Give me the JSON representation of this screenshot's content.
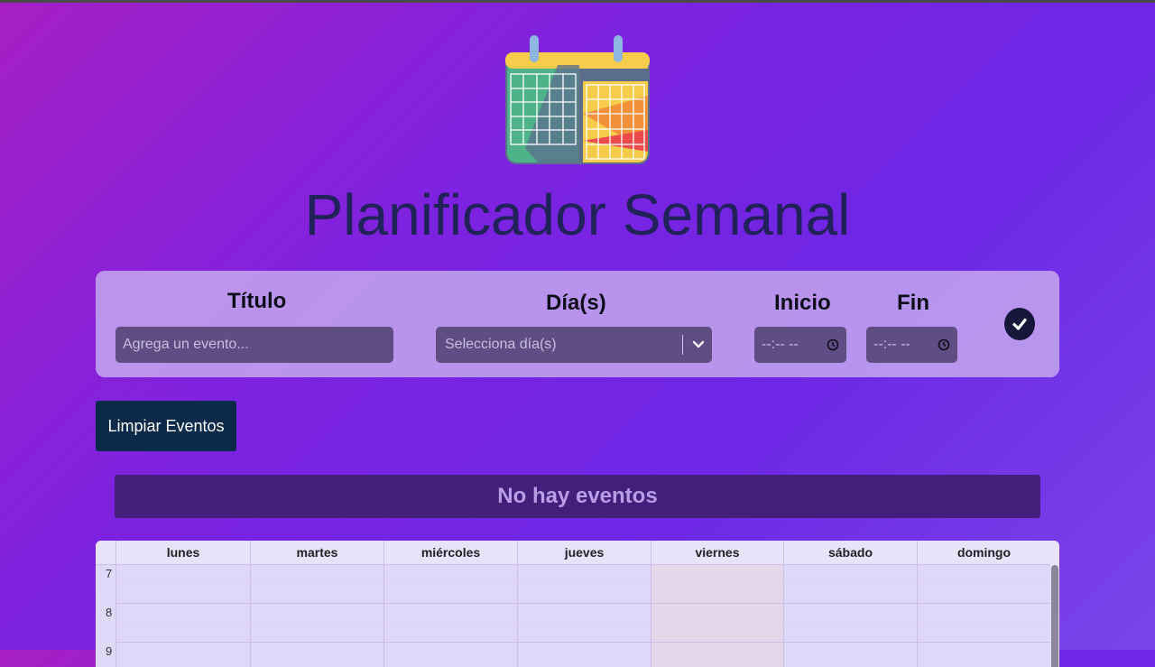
{
  "app": {
    "title": "Planificador Semanal"
  },
  "form": {
    "title_label": "Título",
    "title_placeholder": "Agrega un evento...",
    "days_label": "Día(s)",
    "days_placeholder": "Selecciona día(s)",
    "start_label": "Inicio",
    "start_value": "--:-- --",
    "end_label": "Fin",
    "end_value": "--:-- --",
    "submit_icon": "check-icon"
  },
  "actions": {
    "clear_label": "Limpiar Eventos"
  },
  "events": {
    "empty_message": "No hay eventos"
  },
  "calendar": {
    "days": [
      "lunes",
      "martes",
      "miércoles",
      "jueves",
      "viernes",
      "sábado",
      "domingo"
    ],
    "hours": [
      "7",
      "8",
      "9"
    ],
    "highlighted_day": "viernes"
  },
  "colors": {
    "accent": "#7d22e0",
    "title": "#22225a",
    "clear_button": "#0b2a4a",
    "empty_banner": "#431e7a"
  }
}
